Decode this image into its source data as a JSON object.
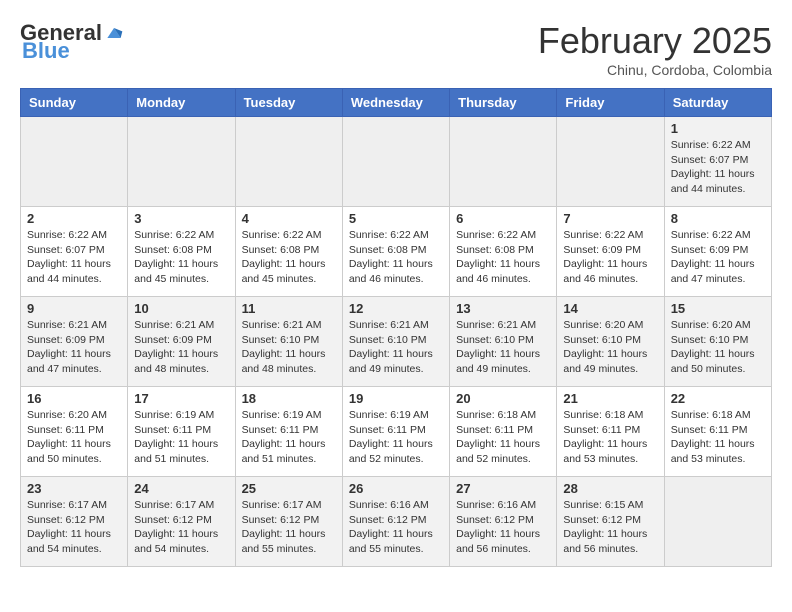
{
  "header": {
    "logo_general": "General",
    "logo_blue": "Blue",
    "month": "February 2025",
    "location": "Chinu, Cordoba, Colombia"
  },
  "weekdays": [
    "Sunday",
    "Monday",
    "Tuesday",
    "Wednesday",
    "Thursday",
    "Friday",
    "Saturday"
  ],
  "weeks": [
    [
      {
        "day": "",
        "info": ""
      },
      {
        "day": "",
        "info": ""
      },
      {
        "day": "",
        "info": ""
      },
      {
        "day": "",
        "info": ""
      },
      {
        "day": "",
        "info": ""
      },
      {
        "day": "",
        "info": ""
      },
      {
        "day": "1",
        "info": "Sunrise: 6:22 AM\nSunset: 6:07 PM\nDaylight: 11 hours\nand 44 minutes."
      }
    ],
    [
      {
        "day": "2",
        "info": "Sunrise: 6:22 AM\nSunset: 6:07 PM\nDaylight: 11 hours\nand 44 minutes."
      },
      {
        "day": "3",
        "info": "Sunrise: 6:22 AM\nSunset: 6:08 PM\nDaylight: 11 hours\nand 45 minutes."
      },
      {
        "day": "4",
        "info": "Sunrise: 6:22 AM\nSunset: 6:08 PM\nDaylight: 11 hours\nand 45 minutes."
      },
      {
        "day": "5",
        "info": "Sunrise: 6:22 AM\nSunset: 6:08 PM\nDaylight: 11 hours\nand 46 minutes."
      },
      {
        "day": "6",
        "info": "Sunrise: 6:22 AM\nSunset: 6:08 PM\nDaylight: 11 hours\nand 46 minutes."
      },
      {
        "day": "7",
        "info": "Sunrise: 6:22 AM\nSunset: 6:09 PM\nDaylight: 11 hours\nand 46 minutes."
      },
      {
        "day": "8",
        "info": "Sunrise: 6:22 AM\nSunset: 6:09 PM\nDaylight: 11 hours\nand 47 minutes."
      }
    ],
    [
      {
        "day": "9",
        "info": "Sunrise: 6:21 AM\nSunset: 6:09 PM\nDaylight: 11 hours\nand 47 minutes."
      },
      {
        "day": "10",
        "info": "Sunrise: 6:21 AM\nSunset: 6:09 PM\nDaylight: 11 hours\nand 48 minutes."
      },
      {
        "day": "11",
        "info": "Sunrise: 6:21 AM\nSunset: 6:10 PM\nDaylight: 11 hours\nand 48 minutes."
      },
      {
        "day": "12",
        "info": "Sunrise: 6:21 AM\nSunset: 6:10 PM\nDaylight: 11 hours\nand 49 minutes."
      },
      {
        "day": "13",
        "info": "Sunrise: 6:21 AM\nSunset: 6:10 PM\nDaylight: 11 hours\nand 49 minutes."
      },
      {
        "day": "14",
        "info": "Sunrise: 6:20 AM\nSunset: 6:10 PM\nDaylight: 11 hours\nand 49 minutes."
      },
      {
        "day": "15",
        "info": "Sunrise: 6:20 AM\nSunset: 6:10 PM\nDaylight: 11 hours\nand 50 minutes."
      }
    ],
    [
      {
        "day": "16",
        "info": "Sunrise: 6:20 AM\nSunset: 6:11 PM\nDaylight: 11 hours\nand 50 minutes."
      },
      {
        "day": "17",
        "info": "Sunrise: 6:19 AM\nSunset: 6:11 PM\nDaylight: 11 hours\nand 51 minutes."
      },
      {
        "day": "18",
        "info": "Sunrise: 6:19 AM\nSunset: 6:11 PM\nDaylight: 11 hours\nand 51 minutes."
      },
      {
        "day": "19",
        "info": "Sunrise: 6:19 AM\nSunset: 6:11 PM\nDaylight: 11 hours\nand 52 minutes."
      },
      {
        "day": "20",
        "info": "Sunrise: 6:18 AM\nSunset: 6:11 PM\nDaylight: 11 hours\nand 52 minutes."
      },
      {
        "day": "21",
        "info": "Sunrise: 6:18 AM\nSunset: 6:11 PM\nDaylight: 11 hours\nand 53 minutes."
      },
      {
        "day": "22",
        "info": "Sunrise: 6:18 AM\nSunset: 6:11 PM\nDaylight: 11 hours\nand 53 minutes."
      }
    ],
    [
      {
        "day": "23",
        "info": "Sunrise: 6:17 AM\nSunset: 6:12 PM\nDaylight: 11 hours\nand 54 minutes."
      },
      {
        "day": "24",
        "info": "Sunrise: 6:17 AM\nSunset: 6:12 PM\nDaylight: 11 hours\nand 54 minutes."
      },
      {
        "day": "25",
        "info": "Sunrise: 6:17 AM\nSunset: 6:12 PM\nDaylight: 11 hours\nand 55 minutes."
      },
      {
        "day": "26",
        "info": "Sunrise: 6:16 AM\nSunset: 6:12 PM\nDaylight: 11 hours\nand 55 minutes."
      },
      {
        "day": "27",
        "info": "Sunrise: 6:16 AM\nSunset: 6:12 PM\nDaylight: 11 hours\nand 56 minutes."
      },
      {
        "day": "28",
        "info": "Sunrise: 6:15 AM\nSunset: 6:12 PM\nDaylight: 11 hours\nand 56 minutes."
      },
      {
        "day": "",
        "info": ""
      }
    ]
  ]
}
